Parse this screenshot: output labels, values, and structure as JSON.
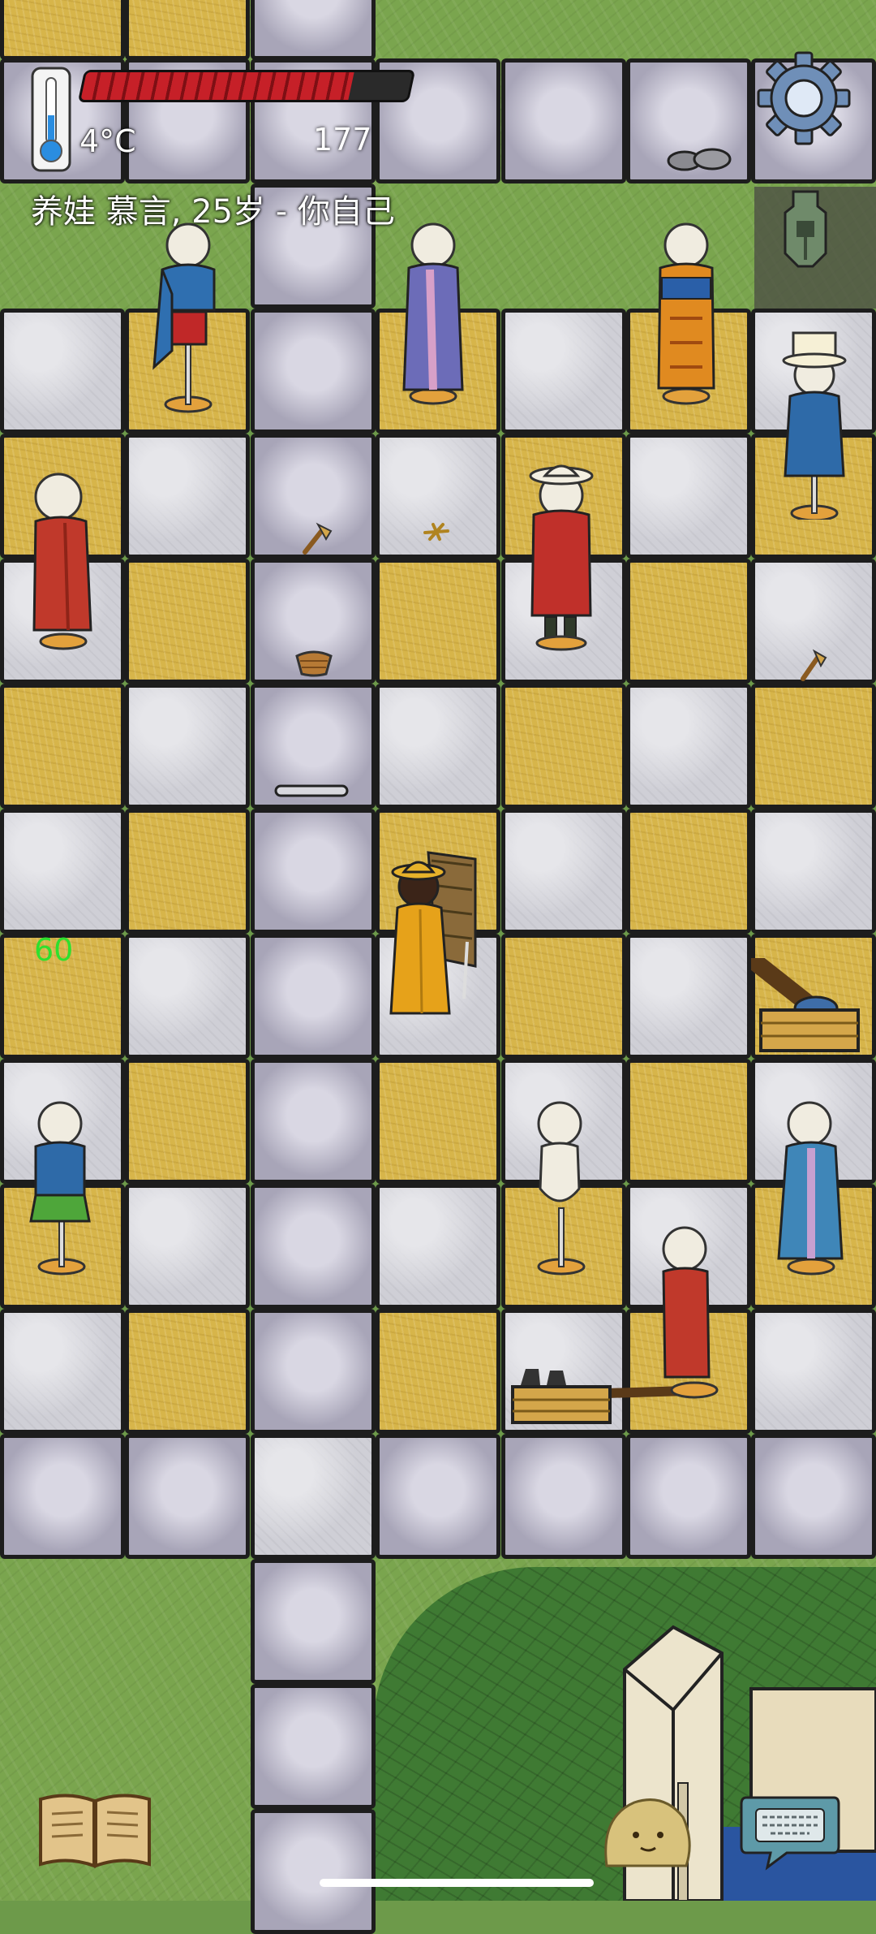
{
  "hud": {
    "temperature": "4°C",
    "food_level": 0.82,
    "count": "177",
    "player_name": "养娃 慕言, 25岁 - 你自己",
    "fps": "60"
  },
  "icons": {
    "settings": "gear-icon",
    "currency": "spade-coin-icon",
    "thermometer": "thermometer-icon",
    "book": "book-icon",
    "emote": "emote-face-icon",
    "keyboard": "keyboard-chat-icon"
  },
  "colors": {
    "health_red": "#c62028",
    "fps_green": "#2ee02e",
    "tile_yellow": "#d7b54a",
    "tile_gray": "#cfcfd6",
    "grass": "#7aa54e"
  }
}
